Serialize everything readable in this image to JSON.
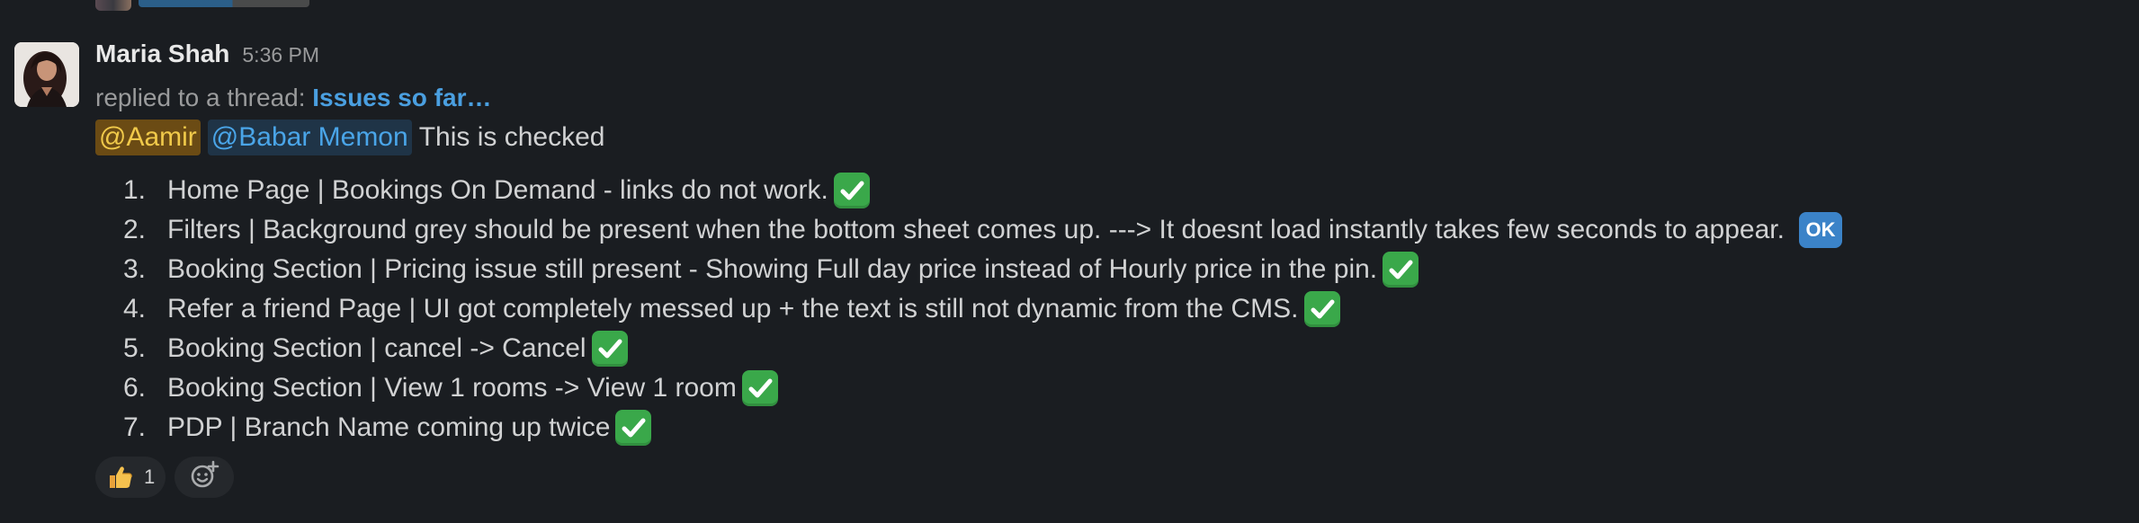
{
  "message": {
    "sender": "Maria Shah",
    "timestamp": "5:36 PM",
    "thread_prefix": "replied to a thread:",
    "thread_link": "Issues so far…",
    "mentions": [
      "@Aamir",
      "@Babar Memon"
    ],
    "body_text": "This is checked",
    "checklist": [
      {
        "num": "1.",
        "text": "Home Page | Bookings On Demand - links do not work.",
        "status": "white-check-mark-icon"
      },
      {
        "num": "2.",
        "text": "Filters | Background grey should be present when the bottom sheet comes up. ---> It doesnt load instantly takes few seconds to appear.",
        "status": "ok-icon",
        "status_label": "OK"
      },
      {
        "num": "3.",
        "text": "Booking Section | Pricing issue still present - Showing Full day price instead of Hourly price in the pin.",
        "status": "white-check-mark-icon"
      },
      {
        "num": "4.",
        "text": "Refer a friend Page | UI got completely messed up + the text is still not dynamic from the CMS.",
        "status": "white-check-mark-icon"
      },
      {
        "num": "5.",
        "text": "Booking Section | cancel -> Cancel",
        "status": "white-check-mark-icon"
      },
      {
        "num": "6.",
        "text": "Booking Section | View 1 rooms -> View 1 room",
        "status": "white-check-mark-icon"
      },
      {
        "num": "7.",
        "text": "PDP | Branch Name coming up twice",
        "status": "white-check-mark-icon"
      }
    ],
    "reactions": [
      {
        "emoji": "thumbs-up-icon",
        "count": "1"
      }
    ],
    "add_reaction_icon": "add-reaction-icon"
  },
  "colors": {
    "background": "#1a1d21",
    "link": "#4a9fe0",
    "mention_self_bg": "#6b4b14",
    "mention_self_fg": "#f0c94a",
    "mention_other_bg": "#1f3447",
    "mention_other_fg": "#4aa5e8",
    "check_green": "#3aa84a",
    "ok_blue": "#3b83c8"
  }
}
